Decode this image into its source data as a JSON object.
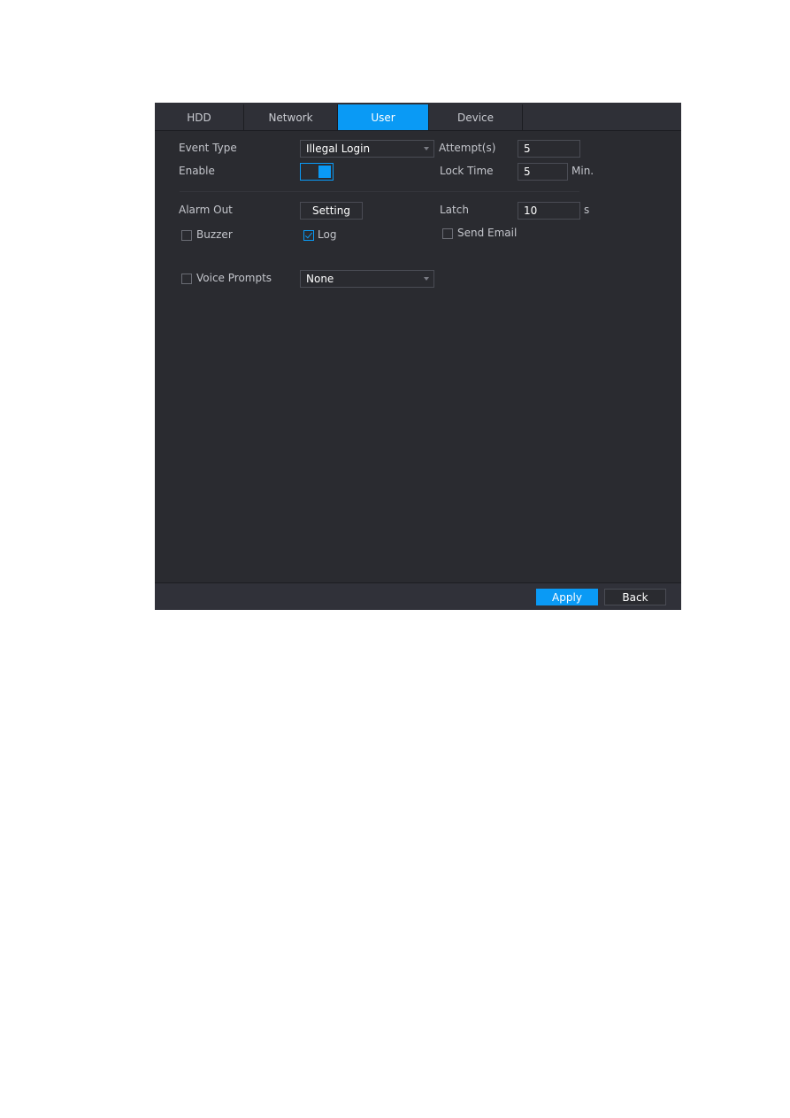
{
  "tabs": [
    {
      "label": "HDD",
      "active": false
    },
    {
      "label": "Network",
      "active": false
    },
    {
      "label": "User",
      "active": true
    },
    {
      "label": "Device",
      "active": false
    }
  ],
  "form": {
    "event_type_label": "Event Type",
    "event_type_value": "Illegal Login",
    "enable_label": "Enable",
    "enable_on": true,
    "attempts_label": "Attempt(s)",
    "attempts_value": "5",
    "lock_time_label": "Lock Time",
    "lock_time_value": "5",
    "lock_time_unit": "Min.",
    "alarm_out_label": "Alarm Out",
    "setting_button": "Setting",
    "latch_label": "Latch",
    "latch_value": "10",
    "latch_unit": "s",
    "buzzer_label": "Buzzer",
    "buzzer_checked": false,
    "log_label": "Log",
    "log_checked": true,
    "send_email_label": "Send Email",
    "send_email_checked": false,
    "voice_prompts_label": "Voice Prompts",
    "voice_prompts_checked": false,
    "voice_prompts_value": "None"
  },
  "footer": {
    "apply_label": "Apply",
    "back_label": "Back"
  },
  "colors": {
    "accent": "#0a9af5",
    "panel_bg": "#2a2b30"
  }
}
